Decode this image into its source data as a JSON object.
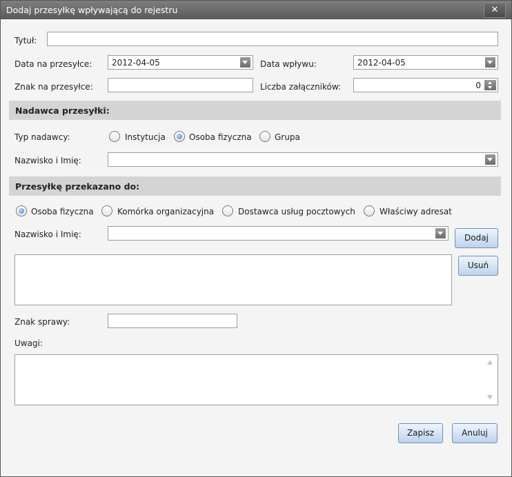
{
  "window": {
    "title": "Dodaj przesyłkę wpływającą do rejestru",
    "close_glyph": "✕"
  },
  "fields": {
    "tytul": {
      "label": "Tytuł:",
      "value": ""
    },
    "data_na_przesylce": {
      "label": "Data na przesyłce:",
      "value": "2012-04-05"
    },
    "data_wplywu": {
      "label": "Data wpływu:",
      "value": "2012-04-05"
    },
    "znak_na_przesylce": {
      "label": "Znak na przesyłce:",
      "value": ""
    },
    "liczba_zalacznikow": {
      "label": "Liczba załączników:",
      "value": "0"
    }
  },
  "nadawca": {
    "header": "Nadawca przesyłki:",
    "typ_label": "Typ nadawcy:",
    "options": [
      "Instytucja",
      "Osoba fizyczna",
      "Grupa"
    ],
    "selected": "Osoba fizyczna",
    "nazwisko_label": "Nazwisko i Imię:",
    "nazwisko_value": ""
  },
  "przekazano": {
    "header": "Przesyłkę przekazano do:",
    "options": [
      "Osoba fizyczna",
      "Komórka organizacyjna",
      "Dostawca usług pocztowych",
      "Właściwy adresat"
    ],
    "selected": "Osoba fizyczna",
    "nazwisko_label": "Nazwisko i Imię:",
    "nazwisko_value": "",
    "add_label": "Dodaj",
    "remove_label": "Usuń"
  },
  "znak_sprawy": {
    "label": "Znak sprawy:",
    "value": ""
  },
  "uwagi": {
    "label": "Uwagi:",
    "value": ""
  },
  "actions": {
    "save_label": "Zapisz",
    "cancel_label": "Anuluj"
  }
}
